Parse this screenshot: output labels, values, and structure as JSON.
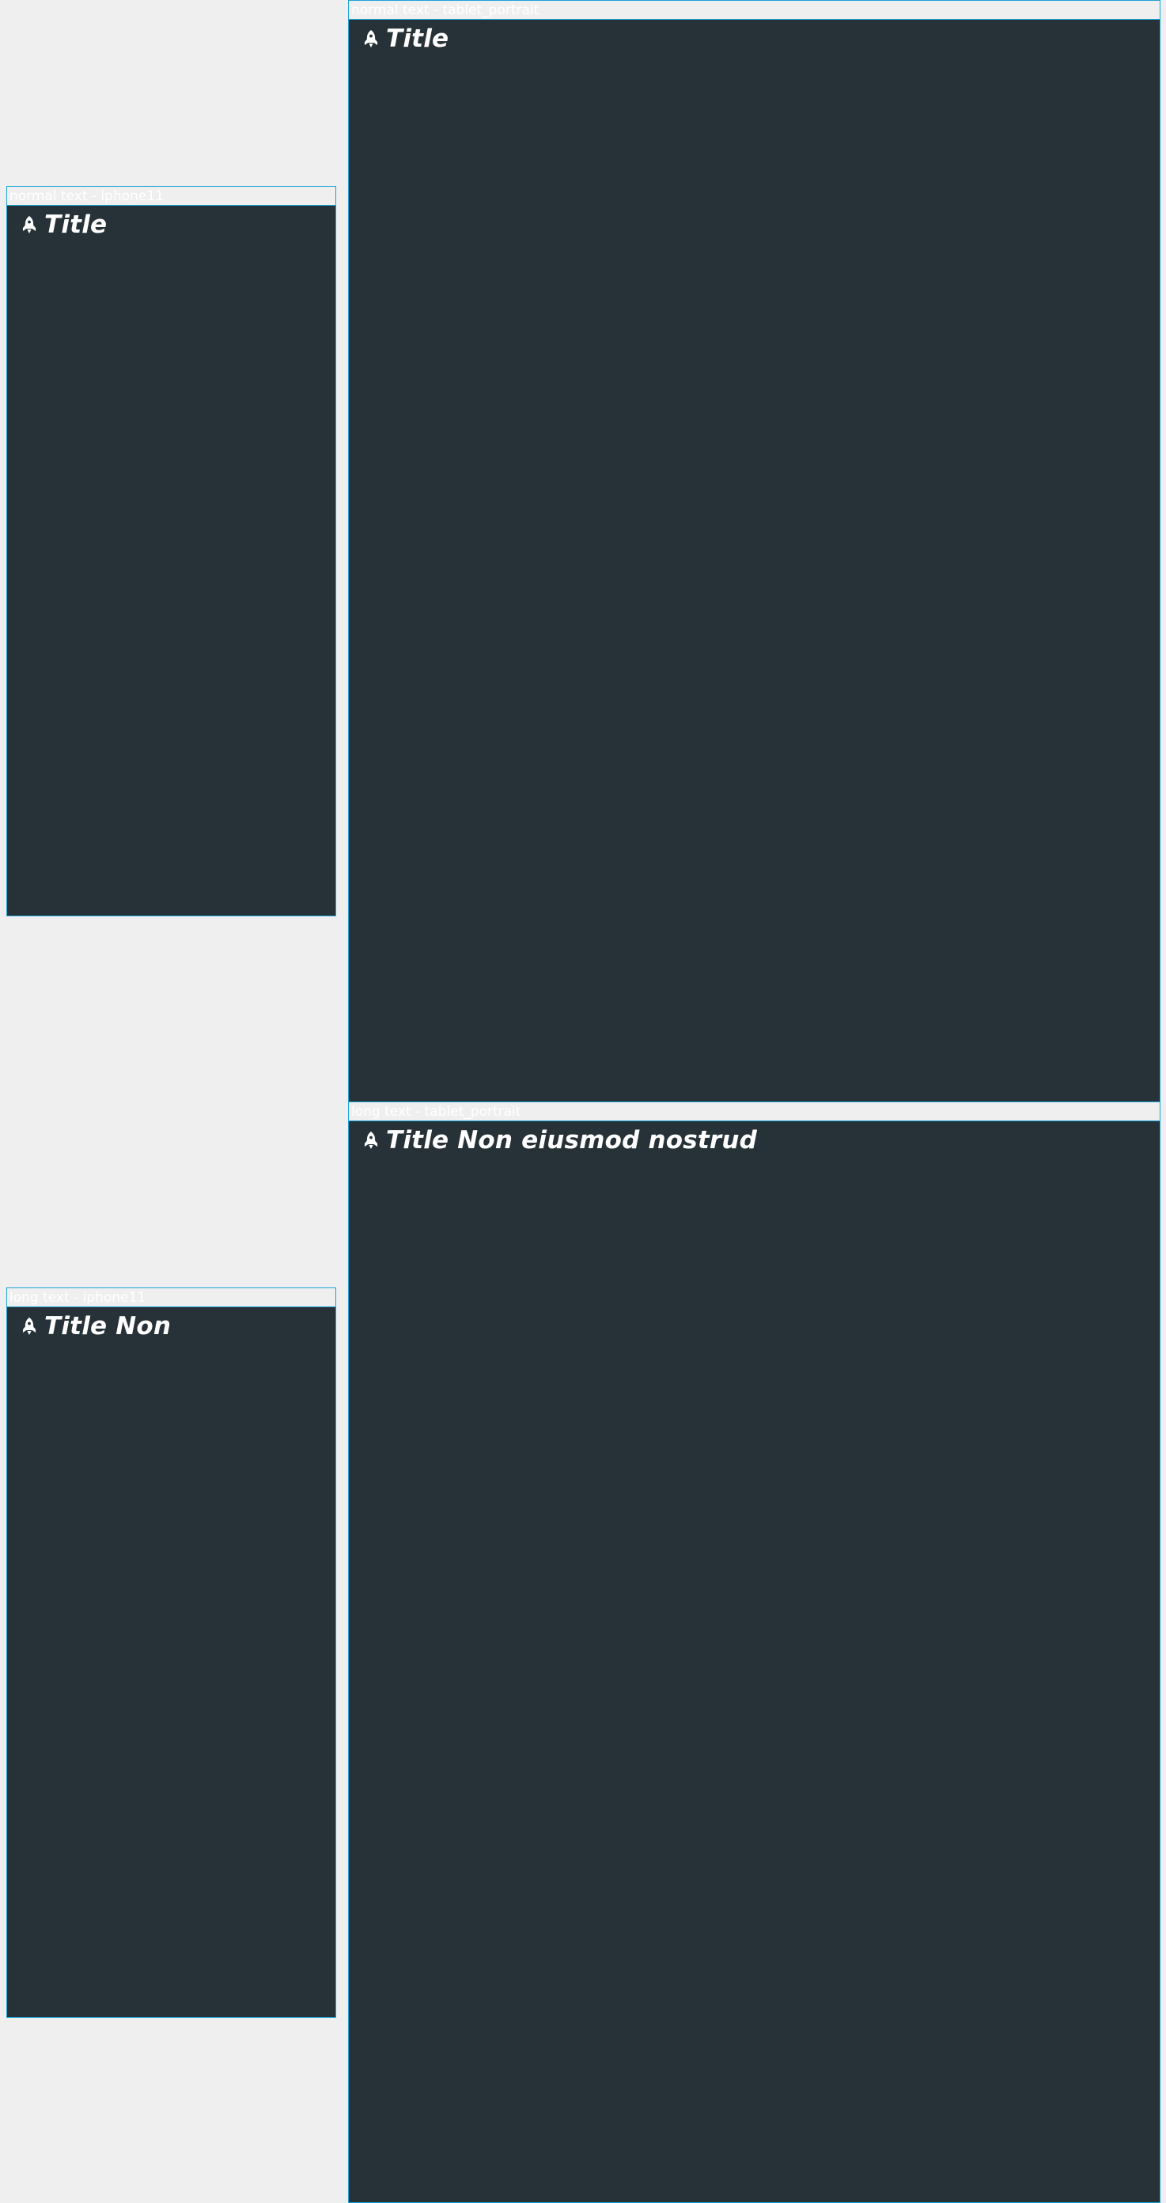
{
  "frames": {
    "normal_iphone": {
      "label": "normal text - iphone11",
      "icon": "rocket-icon",
      "title": "Title"
    },
    "normal_tablet": {
      "label": "normal text - tablet_portrait",
      "icon": "rocket-icon",
      "title": "Title"
    },
    "long_iphone": {
      "label": "long text - iphone11",
      "icon": "rocket-icon",
      "title": "Title Non"
    },
    "long_tablet": {
      "label": "long text - tablet_portrait",
      "icon": "rocket-icon",
      "title": "Title Non eiusmod nostrud"
    }
  },
  "colors": {
    "canvas": "#efefef",
    "frame_border": "#1aa3d9",
    "content_bg": "#263238",
    "text": "#ffffff"
  }
}
